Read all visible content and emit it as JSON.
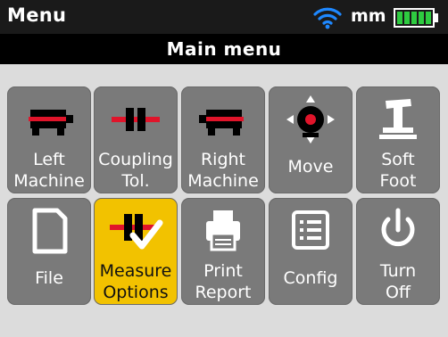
{
  "status": {
    "title": "Menu",
    "units": "mm",
    "wifi_icon": "wifi-icon",
    "battery_icon": "battery-icon"
  },
  "menu": {
    "title": "Main menu"
  },
  "colors": {
    "tile": "#7a7a7a",
    "tile_active": "#f2c200",
    "accent_red": "#e0142a",
    "wifi_blue": "#1e88ff",
    "battery_green": "#2ecc40"
  },
  "tiles": [
    {
      "id": "left-machine",
      "line1": "Left",
      "line2": "Machine",
      "icon": "left-machine-icon",
      "active": false
    },
    {
      "id": "coupling-tol",
      "line1": "Coupling",
      "line2": "Tol.",
      "icon": "coupling-icon",
      "active": false
    },
    {
      "id": "right-machine",
      "line1": "Right",
      "line2": "Machine",
      "icon": "right-machine-icon",
      "active": false
    },
    {
      "id": "move",
      "line1": "Move",
      "line2": "",
      "icon": "move-icon",
      "active": false
    },
    {
      "id": "soft-foot",
      "line1": "Soft",
      "line2": "Foot",
      "icon": "soft-foot-icon",
      "active": false
    },
    {
      "id": "file",
      "line1": "File",
      "line2": "",
      "icon": "file-icon",
      "active": false
    },
    {
      "id": "measure-options",
      "line1": "Measure",
      "line2": "Options",
      "icon": "measure-options-icon",
      "active": true
    },
    {
      "id": "print-report",
      "line1": "Print",
      "line2": "Report",
      "icon": "printer-icon",
      "active": false
    },
    {
      "id": "config",
      "line1": "Config",
      "line2": "",
      "icon": "config-list-icon",
      "active": false
    },
    {
      "id": "turn-off",
      "line1": "Turn",
      "line2": "Off",
      "icon": "power-icon",
      "active": false
    }
  ]
}
